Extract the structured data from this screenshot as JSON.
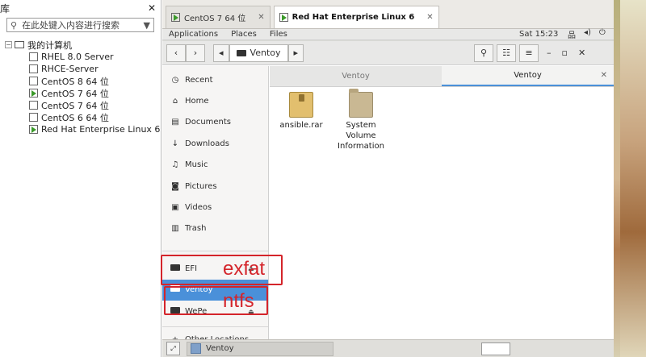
{
  "library": {
    "title": "库",
    "search_placeholder": "在此处键入内容进行搜索",
    "root_label": "我的计算机",
    "vms": [
      {
        "name": "RHEL 8.0 Server",
        "running": false
      },
      {
        "name": "RHCE-Server",
        "running": false
      },
      {
        "name": "CentOS 8 64 位",
        "running": false
      },
      {
        "name": "CentOS 7 64 位",
        "running": true
      },
      {
        "name": "CentOS 7 64 位",
        "running": false
      },
      {
        "name": "CentOS 6 64 位",
        "running": false
      },
      {
        "name": "Red Hat Enterprise Linux 6",
        "running": true
      }
    ]
  },
  "vm_tabs": [
    {
      "label": "CentOS 7 64 位",
      "active": false
    },
    {
      "label": "Red Hat Enterprise Linux 6",
      "active": true
    }
  ],
  "gnome_bar": {
    "menus": [
      "Applications",
      "Places",
      "Files"
    ],
    "clock": "Sat 15:23"
  },
  "files": {
    "path_current": "Ventoy",
    "places": [
      {
        "label": "Recent",
        "icon": "clock-icon"
      },
      {
        "label": "Home",
        "icon": "home-icon"
      },
      {
        "label": "Documents",
        "icon": "document-icon"
      },
      {
        "label": "Downloads",
        "icon": "download-icon"
      },
      {
        "label": "Music",
        "icon": "music-icon"
      },
      {
        "label": "Pictures",
        "icon": "camera-icon"
      },
      {
        "label": "Videos",
        "icon": "video-icon"
      },
      {
        "label": "Trash",
        "icon": "trash-icon"
      }
    ],
    "devices": [
      {
        "label": "EFI",
        "selected": false,
        "eject": true
      },
      {
        "label": "Ventoy",
        "selected": true,
        "eject": false
      },
      {
        "label": "WePe",
        "selected": false,
        "eject": true
      }
    ],
    "other_locations": "Other Locations",
    "content_tabs": [
      {
        "label": "Ventoy",
        "active": false
      },
      {
        "label": "Ventoy",
        "active": true
      }
    ],
    "items": [
      {
        "name": "ansible.rar",
        "kind": "archive"
      },
      {
        "name": "System Volume Information",
        "kind": "folder"
      }
    ]
  },
  "taskbar": {
    "item": "Ventoy"
  },
  "annotations": {
    "exfat": "exfat",
    "ntfs": "ntfs"
  },
  "accent": "#4a90d9",
  "annotation_color": "#d4242a"
}
